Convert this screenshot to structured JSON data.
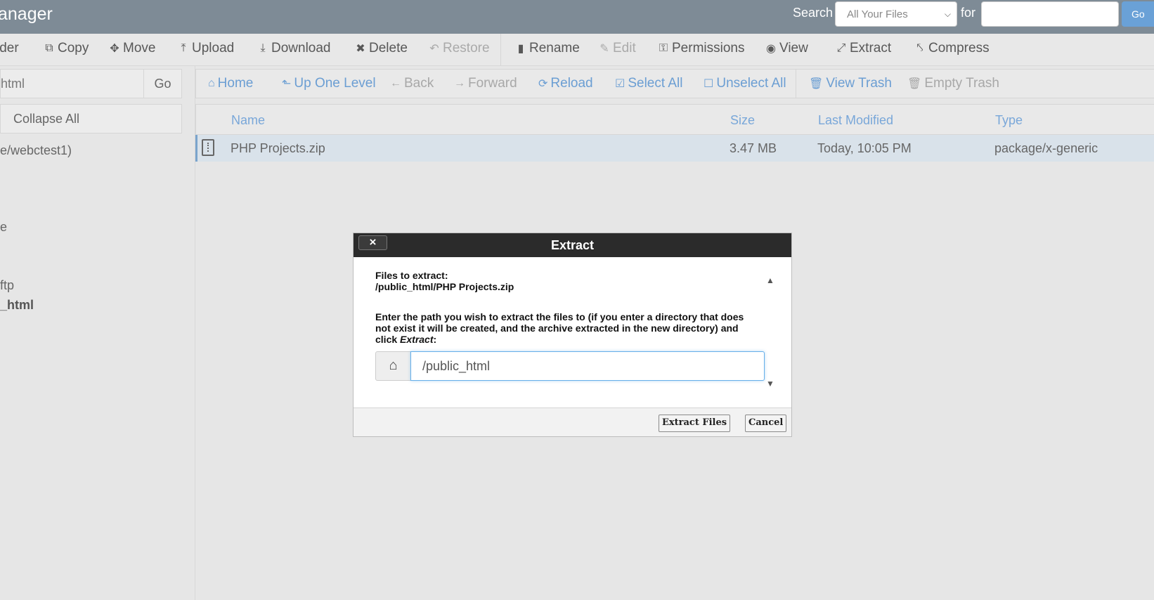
{
  "header": {
    "title": "anager",
    "search_label": "Search",
    "search_scope": "All Your Files",
    "for_label": "for",
    "search_value": "",
    "go_label": "Go"
  },
  "toolbar": {
    "items": [
      {
        "label": "lder",
        "icon": "folder-icon"
      },
      {
        "label": "Copy",
        "icon": "copy-icon"
      },
      {
        "label": "Move",
        "icon": "move-icon"
      },
      {
        "label": "Upload",
        "icon": "upload-icon"
      },
      {
        "label": "Download",
        "icon": "download-icon"
      },
      {
        "label": "Delete",
        "icon": "delete-icon"
      },
      {
        "label": "Restore",
        "icon": "restore-icon"
      },
      {
        "label": "Rename",
        "icon": "rename-icon"
      },
      {
        "label": "Edit",
        "icon": "edit-icon"
      },
      {
        "label": "Permissions",
        "icon": "key-icon"
      },
      {
        "label": "View",
        "icon": "eye-icon"
      },
      {
        "label": "Extract",
        "icon": "extract-icon"
      },
      {
        "label": "Compress",
        "icon": "compress-icon"
      }
    ]
  },
  "sidebar": {
    "path_value": "html",
    "go_label": "Go",
    "collapse_label": "Collapse All",
    "tree": [
      {
        "label": "e/webctest1)"
      },
      {
        "label": "e"
      },
      {
        "label": "ftp"
      },
      {
        "label": "_html"
      }
    ]
  },
  "navbar": {
    "items": [
      {
        "label": "Home",
        "icon": "home-icon"
      },
      {
        "label": "Up One Level",
        "icon": "up-level-icon"
      },
      {
        "label": "Back",
        "icon": "back-arrow-icon"
      },
      {
        "label": "Forward",
        "icon": "forward-arrow-icon"
      },
      {
        "label": "Reload",
        "icon": "reload-icon"
      },
      {
        "label": "Select All",
        "icon": "checkbox-checked-icon"
      },
      {
        "label": "Unselect All",
        "icon": "checkbox-empty-icon"
      },
      {
        "label": "View Trash",
        "icon": "trash-icon"
      },
      {
        "label": "Empty Trash",
        "icon": "trash-icon"
      }
    ]
  },
  "table": {
    "columns": [
      "Name",
      "Size",
      "Last Modified",
      "Type"
    ],
    "rows": [
      {
        "name": "PHP Projects.zip",
        "size": "3.47 MB",
        "modified": "Today, 10:05 PM",
        "type": "package/x-generic"
      }
    ]
  },
  "dialog": {
    "title": "Extract",
    "close_glyph": "×",
    "files_label": "Files to extract:",
    "file_path": "/public_html/PHP Projects.zip",
    "instruction_before": "Enter the path you wish to extract the files to (if you enter a directory that does not exist it will be created, and the archive extracted in the new directory) and click ",
    "instruction_em": "Extract",
    "instruction_after": ":",
    "path_value": "/public_html",
    "extract_button": "Extract Files",
    "cancel_button": "Cancel"
  },
  "colors": {
    "header_bg": "#7e8b96",
    "link_blue": "#6b9ed3",
    "selected_row": "#d9e2ea",
    "dialog_title_bg": "#2b2b2b",
    "go_button": "#6aa1d7"
  }
}
